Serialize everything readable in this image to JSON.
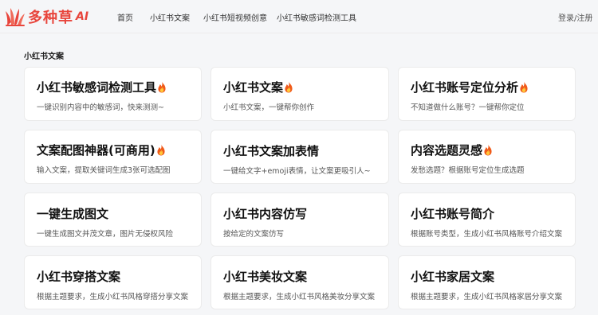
{
  "brand": {
    "name": "多种草",
    "ai": "AI",
    "color": "#e8453c"
  },
  "nav": [
    "首页",
    "小红书文案",
    "小红书短视频创意",
    "小红书敏感词检测工具"
  ],
  "login": "登录/注册",
  "section": {
    "title": "小红书文案"
  },
  "cards": [
    {
      "title": "小红书敏感词检测工具",
      "desc": "一键识别内容中的敏感词，快来测测~",
      "hot": true
    },
    {
      "title": "小红书文案",
      "desc": "小红书文案，一键帮你创作",
      "hot": true
    },
    {
      "title": "小红书账号定位分析",
      "desc": "不知道做什么账号？一键帮你定位",
      "hot": true
    },
    {
      "title": "文案配图神器(可商用)",
      "desc": "输入文案，提取关键词生成3张可选配图",
      "hot": true
    },
    {
      "title": "小红书文案加表情",
      "desc": "一键给文字+emoji表情，让文案更吸引人~",
      "hot": false
    },
    {
      "title": "内容选题灵感",
      "desc": "发愁选题？根据账号定位生成选题",
      "hot": true
    },
    {
      "title": "一键生成图文",
      "desc": "一键生成图文并茂文章，图片无侵权风险",
      "hot": false
    },
    {
      "title": "小红书内容仿写",
      "desc": "按给定的文案仿写",
      "hot": false
    },
    {
      "title": "小红书账号简介",
      "desc": "根据账号类型，生成小红书风格账号介绍文案",
      "hot": false
    },
    {
      "title": "小红书穿搭文案",
      "desc": "根据主题要求，生成小红书风格穿搭分享文案",
      "hot": false
    },
    {
      "title": "小红书美妆文案",
      "desc": "根据主题要求，生成小红书风格美妆分享文案",
      "hot": false
    },
    {
      "title": "小红书家居文案",
      "desc": "根据主题要求，生成小红书风格家居分享文案",
      "hot": false
    }
  ]
}
